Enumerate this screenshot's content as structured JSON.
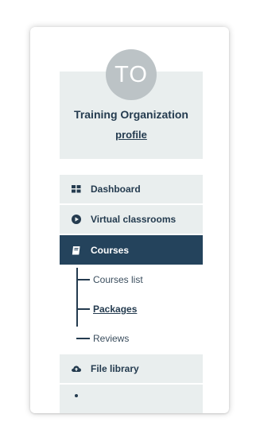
{
  "profile": {
    "avatar_initials": "TO",
    "org_name": "Training Organization",
    "profile_link": "profile"
  },
  "nav": {
    "items": [
      {
        "label": "Dashboard",
        "icon": "grid-icon"
      },
      {
        "label": "Virtual classrooms",
        "icon": "play-circle-icon"
      },
      {
        "label": "Courses",
        "icon": "book-icon",
        "active": true
      },
      {
        "label": "File library",
        "icon": "cloud-upload-icon"
      }
    ],
    "courses_sub": [
      {
        "label": "Courses list"
      },
      {
        "label": "Packages",
        "selected": true
      },
      {
        "label": "Reviews"
      }
    ]
  },
  "colors": {
    "panel_bg": "#e9eeee",
    "active_bg": "#24435c",
    "text_dark": "#243b4f",
    "avatar_bg": "#bcc3c6"
  }
}
